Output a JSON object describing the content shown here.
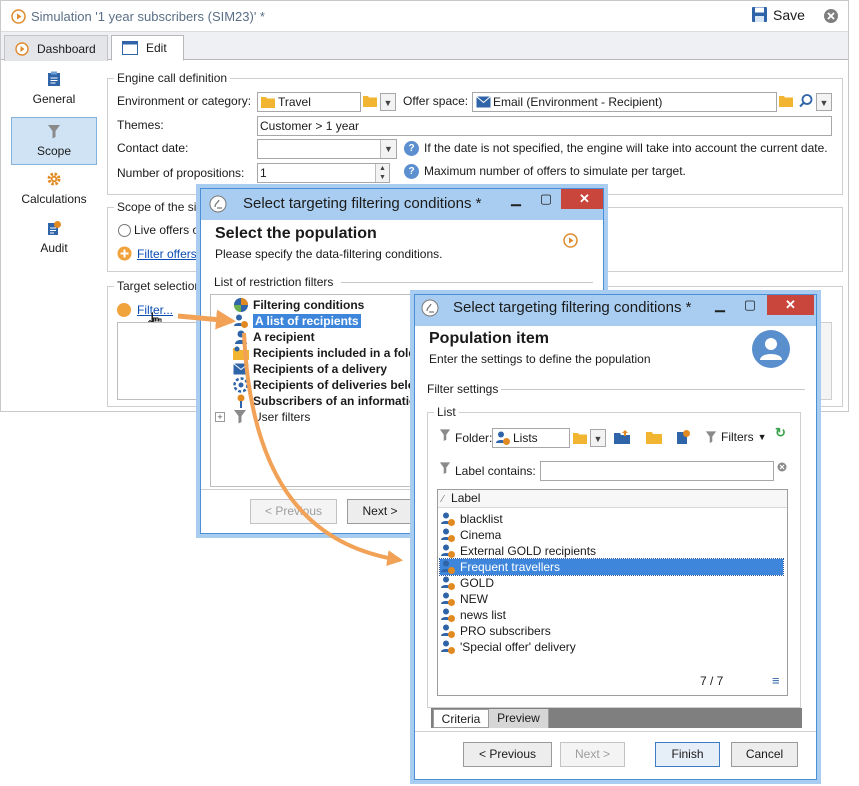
{
  "main": {
    "title": "Simulation '1 year subscribers (SIM23)' *",
    "save_label": "Save",
    "tabs": [
      {
        "label": "Dashboard",
        "active": false
      },
      {
        "label": "Edit",
        "active": true
      }
    ],
    "nav": [
      {
        "label": "General",
        "icon": "clipboard-icon"
      },
      {
        "label": "Scope",
        "icon": "funnel-icon",
        "selected": true
      },
      {
        "label": "Calculations",
        "icon": "gear-icon"
      },
      {
        "label": "Audit",
        "icon": "audit-icon"
      }
    ],
    "engine": {
      "legend": "Engine call definition",
      "env_label": "Environment or category:",
      "env_value": "Travel",
      "offer_space_label": "Offer space:",
      "offer_space_value": "Email (Environment - Recipient)",
      "themes_label": "Themes:",
      "themes_value": "Customer > 1 year",
      "contact_date_label": "Contact date:",
      "contact_date_value": "",
      "contact_date_help": "If the date is not specified, the engine will take into account the current date.",
      "propositions_label": "Number of propositions:",
      "propositions_value": "1",
      "propositions_help": "Maximum number of offers to simulate per target."
    },
    "scope": {
      "legend_partial": "Scope of the sir",
      "live_offers_partial": "Live offers o",
      "filter_offers_partial": "Filter offers."
    },
    "target": {
      "legend_partial": "Target selection",
      "filter_link": "Filter..."
    }
  },
  "dialog1": {
    "title": "Select targeting filtering conditions *",
    "heading": "Select the population",
    "subheading": "Please specify the data-filtering conditions.",
    "section": "List of restriction filters",
    "items": [
      {
        "label": "Filtering conditions",
        "bold": true
      },
      {
        "label": "A list of recipients",
        "bold": true,
        "selected": true
      },
      {
        "label": "A recipient",
        "bold": true
      },
      {
        "label": "Recipients included in a fold",
        "bold": true
      },
      {
        "label": "Recipients of a delivery",
        "bold": true
      },
      {
        "label": "Recipients of deliveries belo",
        "bold": true
      },
      {
        "label": "Subscribers of an informatio",
        "bold": true
      },
      {
        "label": "User filters",
        "bold": false
      }
    ],
    "previous": "< Previous",
    "next": "Next >"
  },
  "dialog2": {
    "title": "Select targeting filtering conditions *",
    "heading": "Population item",
    "subheading": "Enter the settings to define the population",
    "section": "Filter settings",
    "list_legend": "List",
    "folder_label": "Folder:",
    "folder_value": "Lists",
    "filters_label": "Filters",
    "label_contains": "Label contains:",
    "label_contains_value": "",
    "column_header": "Label",
    "items": [
      {
        "label": "blacklist"
      },
      {
        "label": "Cinema"
      },
      {
        "label": "External GOLD recipients"
      },
      {
        "label": "Frequent travellers",
        "selected": true
      },
      {
        "label": "GOLD"
      },
      {
        "label": "NEW"
      },
      {
        "label": "news list"
      },
      {
        "label": "PRO subscribers"
      },
      {
        "label": "'Special offer' delivery"
      }
    ],
    "count": "7 / 7",
    "tabs": [
      {
        "label": "Criteria",
        "active": true
      },
      {
        "label": "Preview",
        "active": false
      }
    ],
    "previous": "< Previous",
    "next": "Next >",
    "finish": "Finish",
    "cancel": "Cancel"
  },
  "colors": {
    "accent": "#3e86db",
    "dialog_border": "#a9cdf0",
    "arrow": "#f2a257",
    "close": "#c9463d"
  }
}
